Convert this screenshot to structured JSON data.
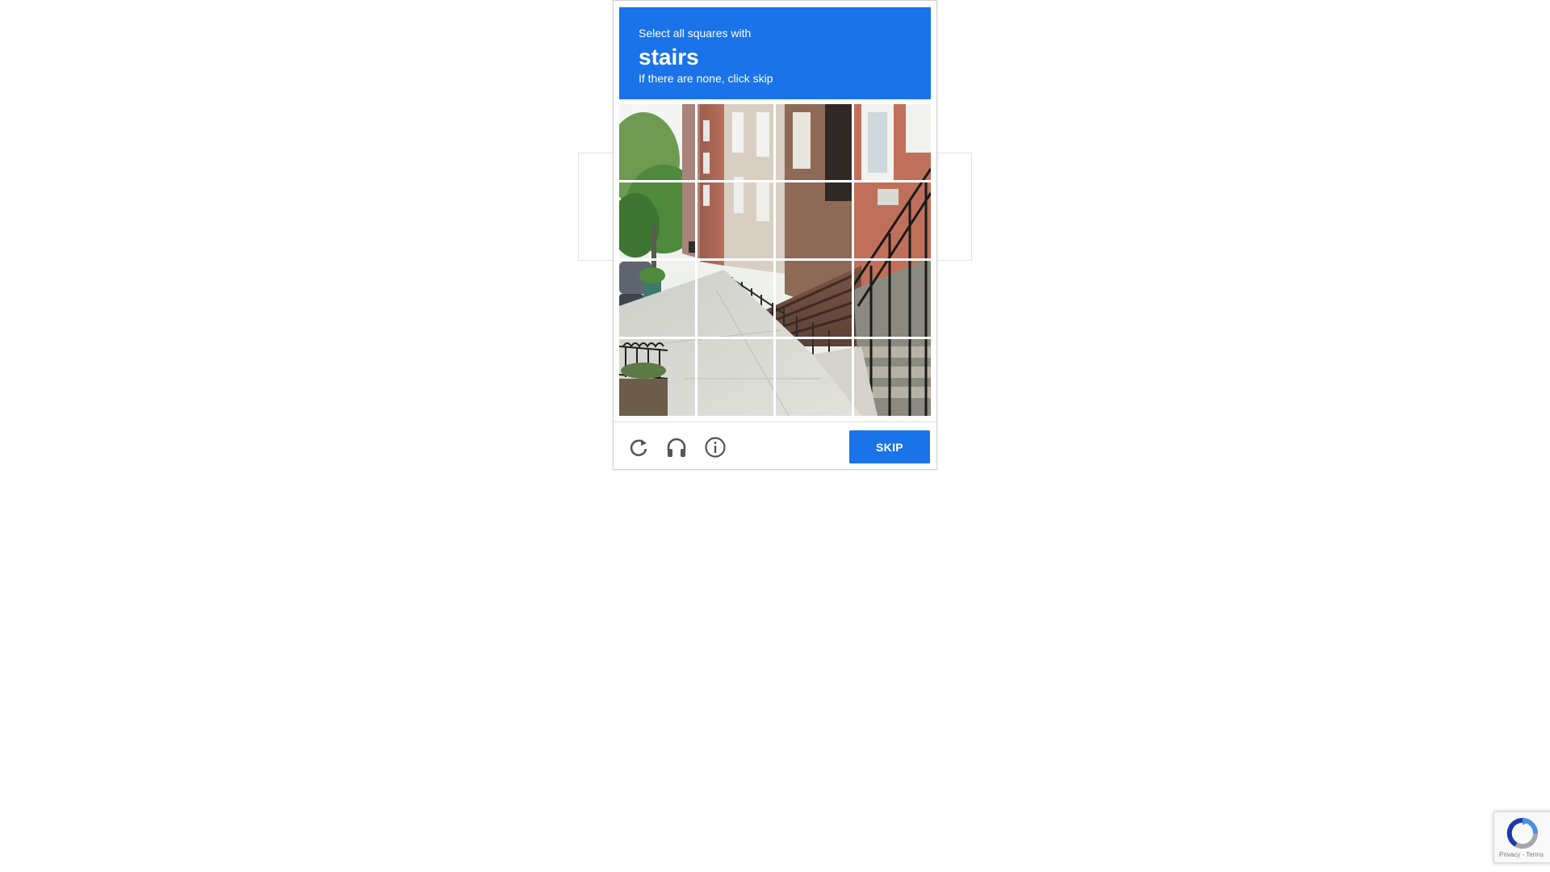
{
  "challenge": {
    "instruction_line1": "Select all squares with",
    "keyword": "stairs",
    "instruction_line3": "If there are none, click skip",
    "header_color": "#1a73e8",
    "grid": {
      "rows": 4,
      "columns": 4,
      "tiles_selected": 0,
      "image_description_icon": "street-stairs-image"
    },
    "footer": {
      "reload_icon": "reload-icon",
      "audio_icon": "headphones-icon",
      "info_icon": "info-icon",
      "skip_label": "SKIP"
    }
  },
  "badge": {
    "icon": "recaptcha-logo-icon",
    "terms_text": "Privacy - Terms"
  }
}
